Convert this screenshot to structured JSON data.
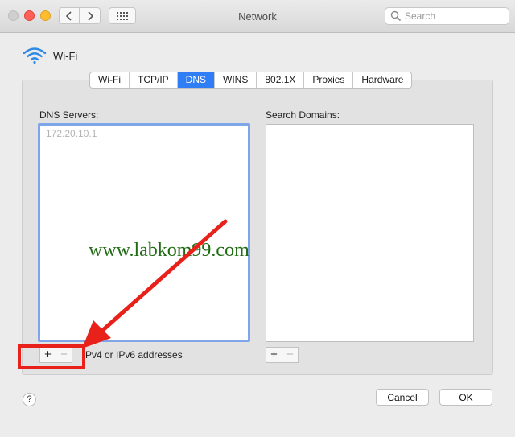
{
  "window": {
    "title": "Network",
    "search_placeholder": "Search"
  },
  "service": {
    "name": "Wi-Fi",
    "icon": "wifi-icon"
  },
  "tabs": [
    {
      "label": "Wi-Fi"
    },
    {
      "label": "TCP/IP"
    },
    {
      "label": "DNS",
      "active": true
    },
    {
      "label": "WINS"
    },
    {
      "label": "802.1X"
    },
    {
      "label": "Proxies"
    },
    {
      "label": "Hardware"
    }
  ],
  "dns": {
    "label": "DNS Servers:",
    "entries": [
      "172.20.10.1"
    ],
    "hint": "Pv4 or IPv6 addresses"
  },
  "search_domains": {
    "label": "Search Domains:"
  },
  "controls": {
    "plus": "+",
    "minus": "−"
  },
  "buttons": {
    "help": "?",
    "cancel": "Cancel",
    "ok": "OK"
  },
  "watermark": "www.labkom99.com",
  "colors": {
    "accent": "#2f7ef6",
    "annotation": "#e8211b",
    "watermark": "#1f6b12"
  }
}
